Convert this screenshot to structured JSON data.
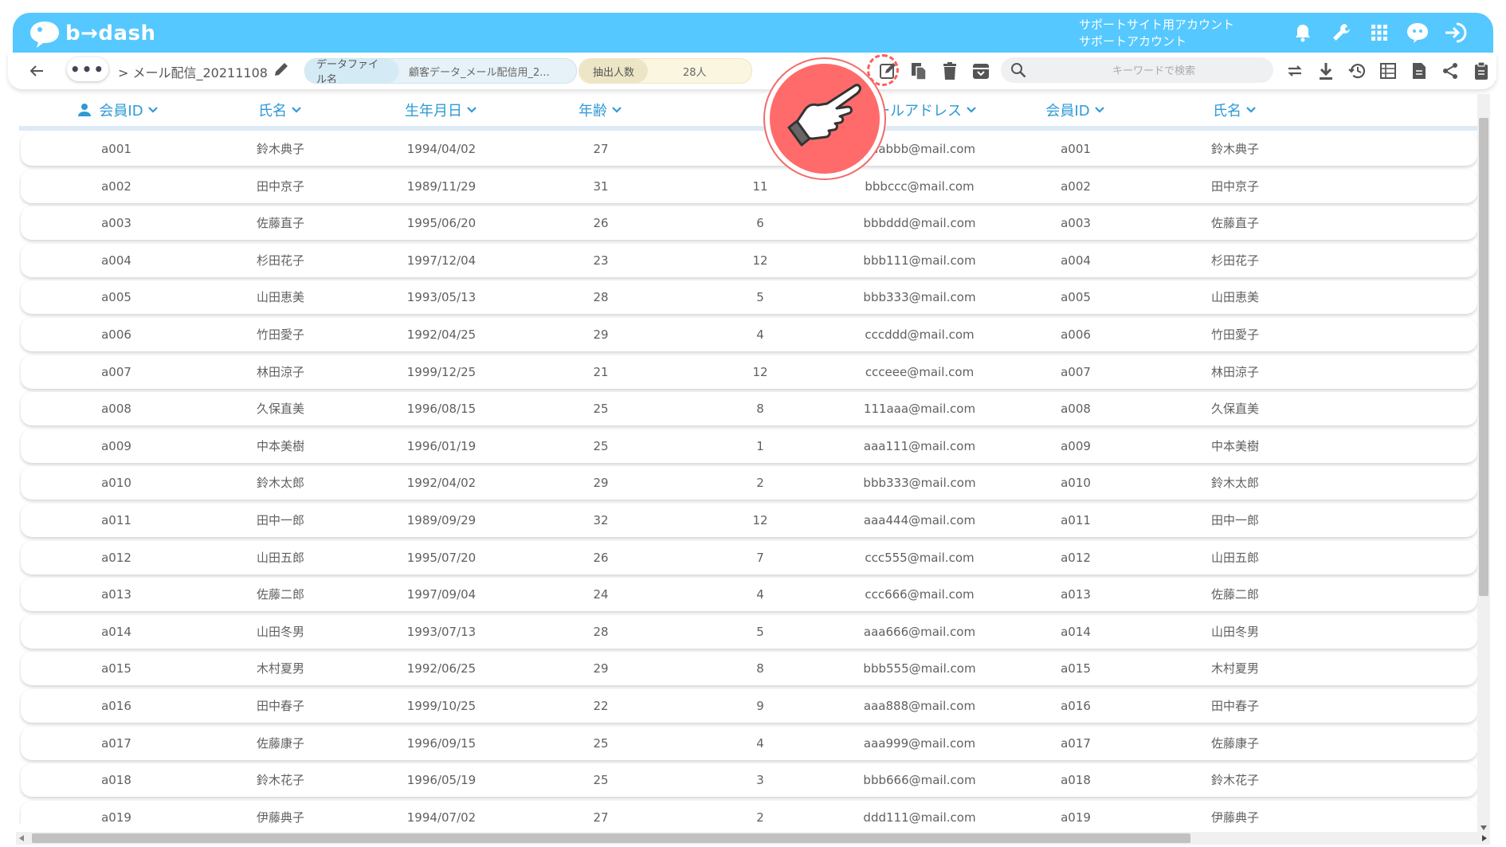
{
  "app": {
    "logo_text": "b→dash",
    "account_line1": "サポートサイト用アカウント",
    "account_line2": "サポートアカウント",
    "brand_color": "#55c8ff",
    "accent_color": "#2e9ad6"
  },
  "header_icons": [
    "bell-icon",
    "wrench-icon",
    "grid-icon",
    "chat-robot-icon",
    "logout-icon"
  ],
  "toolbar": {
    "more_label": "•••",
    "breadcrumb": "> メール配信_20211108",
    "file_label": "データファイル名",
    "file_value": "顧客データ_メール配信用_2...",
    "count_label": "抽出人数",
    "count_value": "28人",
    "search_placeholder": "キーワードで検索",
    "action_icons": [
      "edit-icon",
      "copy-icon",
      "delete-icon",
      "archive-icon"
    ],
    "right_icons": [
      "sync-icon",
      "download-icon",
      "history-icon",
      "table-view-icon",
      "document-icon",
      "share-icon",
      "clipboard-icon"
    ]
  },
  "table": {
    "columns": [
      "会員ID",
      "氏名",
      "生年月日",
      "年齢",
      "",
      "メールアドレス",
      "会員ID",
      "氏名"
    ],
    "rows": [
      [
        "a001",
        "鈴木典子",
        "1994/04/02",
        "27",
        "",
        "aaabbb@mail.com",
        "a001",
        "鈴木典子"
      ],
      [
        "a002",
        "田中京子",
        "1989/11/29",
        "31",
        "11",
        "bbbccc@mail.com",
        "a002",
        "田中京子"
      ],
      [
        "a003",
        "佐藤直子",
        "1995/06/20",
        "26",
        "6",
        "bbbddd@mail.com",
        "a003",
        "佐藤直子"
      ],
      [
        "a004",
        "杉田花子",
        "1997/12/04",
        "23",
        "12",
        "bbb111@mail.com",
        "a004",
        "杉田花子"
      ],
      [
        "a005",
        "山田恵美",
        "1993/05/13",
        "28",
        "5",
        "bbb333@mail.com",
        "a005",
        "山田恵美"
      ],
      [
        "a006",
        "竹田愛子",
        "1992/04/25",
        "29",
        "4",
        "cccddd@mail.com",
        "a006",
        "竹田愛子"
      ],
      [
        "a007",
        "林田涼子",
        "1999/12/25",
        "21",
        "12",
        "ccceee@mail.com",
        "a007",
        "林田涼子"
      ],
      [
        "a008",
        "久保直美",
        "1996/08/15",
        "25",
        "8",
        "111aaa@mail.com",
        "a008",
        "久保直美"
      ],
      [
        "a009",
        "中本美樹",
        "1996/01/19",
        "25",
        "1",
        "aaa111@mail.com",
        "a009",
        "中本美樹"
      ],
      [
        "a010",
        "鈴木太郎",
        "1992/04/02",
        "29",
        "2",
        "bbb333@mail.com",
        "a010",
        "鈴木太郎"
      ],
      [
        "a011",
        "田中一郎",
        "1989/09/29",
        "32",
        "12",
        "aaa444@mail.com",
        "a011",
        "田中一郎"
      ],
      [
        "a012",
        "山田五郎",
        "1995/07/20",
        "26",
        "7",
        "ccc555@mail.com",
        "a012",
        "山田五郎"
      ],
      [
        "a013",
        "佐藤二郎",
        "1997/09/04",
        "24",
        "4",
        "ccc666@mail.com",
        "a013",
        "佐藤二郎"
      ],
      [
        "a014",
        "山田冬男",
        "1993/07/13",
        "28",
        "5",
        "aaa666@mail.com",
        "a014",
        "山田冬男"
      ],
      [
        "a015",
        "木村夏男",
        "1992/06/25",
        "29",
        "8",
        "bbb555@mail.com",
        "a015",
        "木村夏男"
      ],
      [
        "a016",
        "田中春子",
        "1999/10/25",
        "22",
        "9",
        "aaa888@mail.com",
        "a016",
        "田中春子"
      ],
      [
        "a017",
        "佐藤康子",
        "1996/09/15",
        "25",
        "4",
        "aaa999@mail.com",
        "a017",
        "佐藤康子"
      ],
      [
        "a018",
        "鈴木花子",
        "1996/05/19",
        "25",
        "3",
        "bbb666@mail.com",
        "a018",
        "鈴木花子"
      ],
      [
        "a019",
        "伊藤典子",
        "1994/07/02",
        "27",
        "2",
        "ddd111@mail.com",
        "a019",
        "伊藤典子"
      ]
    ]
  },
  "overlay": {
    "icon": "pointing-hand-icon",
    "color": "#ff6b6b"
  }
}
